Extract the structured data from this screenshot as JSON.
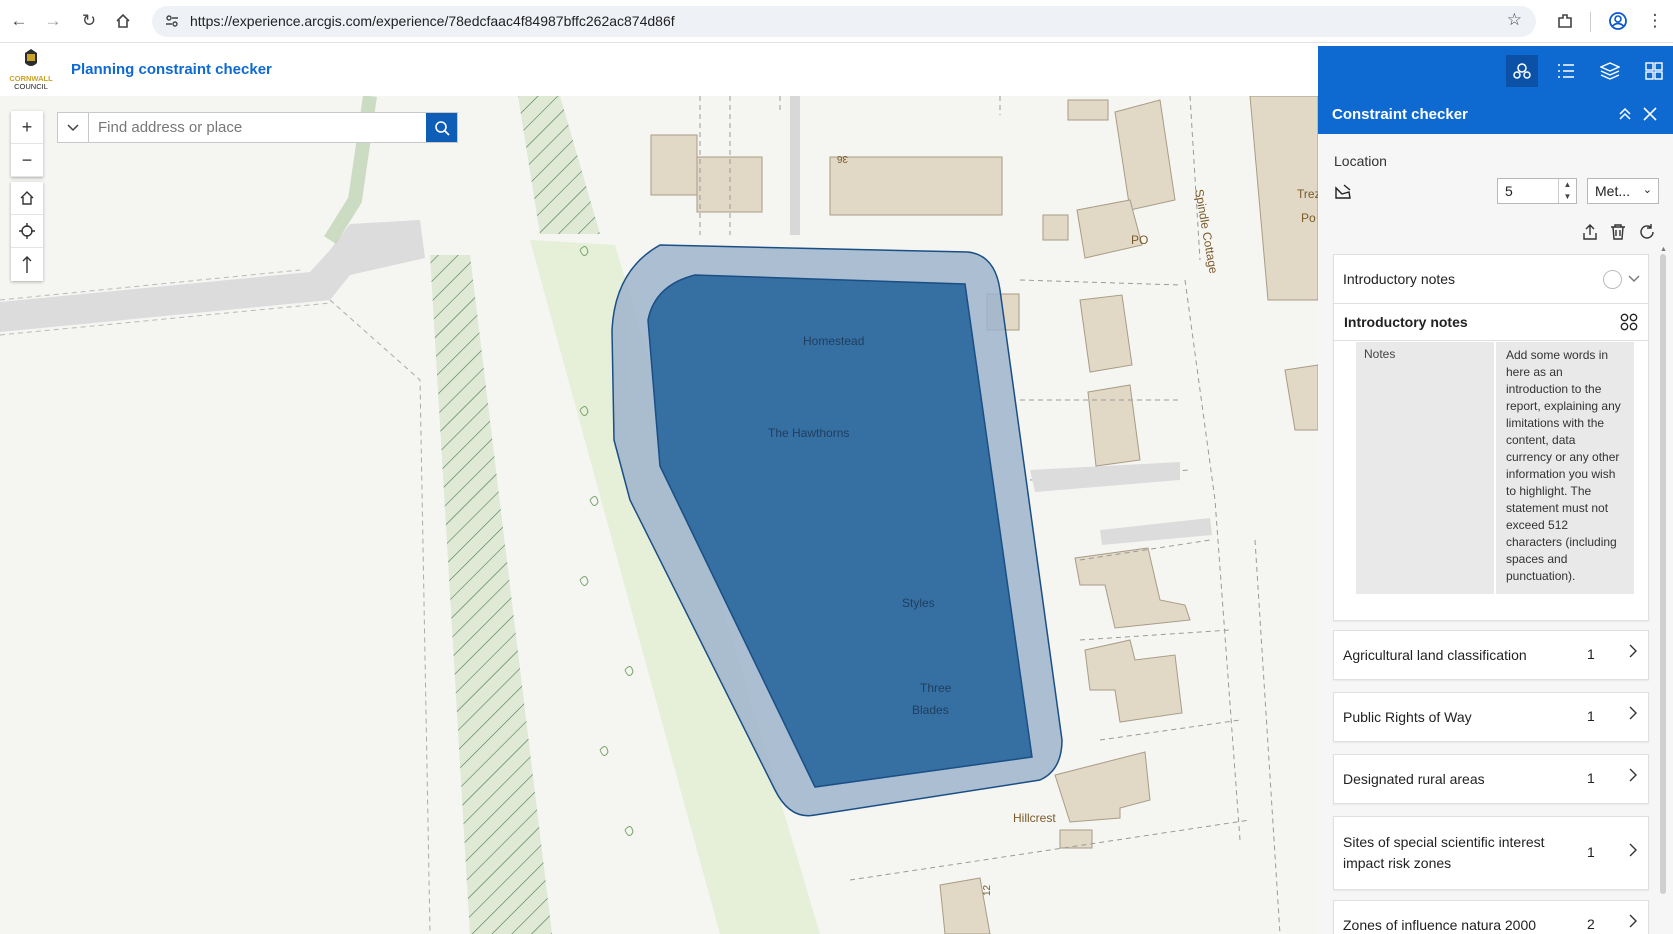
{
  "browser": {
    "url": "https://experience.arcgis.com/experience/78edcfaac4f84987bffc262ac874d86f"
  },
  "app": {
    "logo_text_line1": "CORNWALL",
    "logo_text_line2": "COUNCIL",
    "title": "Planning constraint checker"
  },
  "map": {
    "search_placeholder": "Find address or place",
    "labels": {
      "homestead": "Homestead",
      "hawthorns": "The Hawthorns",
      "styles": "Styles",
      "three": "Three",
      "blades": "Blades",
      "hillcrest": "Hillcrest",
      "spindle": "Spindle Cottage",
      "po": "PO",
      "trez": "Trez",
      "po2": "Po",
      "num36": "36",
      "num12": "12"
    },
    "colors": {
      "parcel_fill": "#2f6a9f",
      "buffer_fill": "#9db4cc",
      "outline": "#1a4f85"
    }
  },
  "panel": {
    "title": "Constraint checker",
    "location_label": "Location",
    "buffer_value": "5",
    "unit": "Met...",
    "intro_header": "Introductory notes",
    "intro_subheader": "Introductory notes",
    "notes_key": "Notes",
    "notes_value": "Add some words in here as an introduction to the report, explaining any limitations with the content, data currency or any other information you wish to highlight. The statement must not exceed 512 characters (including spaces and punctuation).",
    "layers": [
      {
        "name": "Agricultural land classification",
        "count": "1"
      },
      {
        "name": "Public Rights of Way",
        "count": "1"
      },
      {
        "name": "Designated rural areas",
        "count": "1"
      },
      {
        "name": "Sites of special scientific interest impact risk zones",
        "count": "1"
      },
      {
        "name": "Zones of influence natura 2000",
        "count": "2"
      }
    ]
  }
}
